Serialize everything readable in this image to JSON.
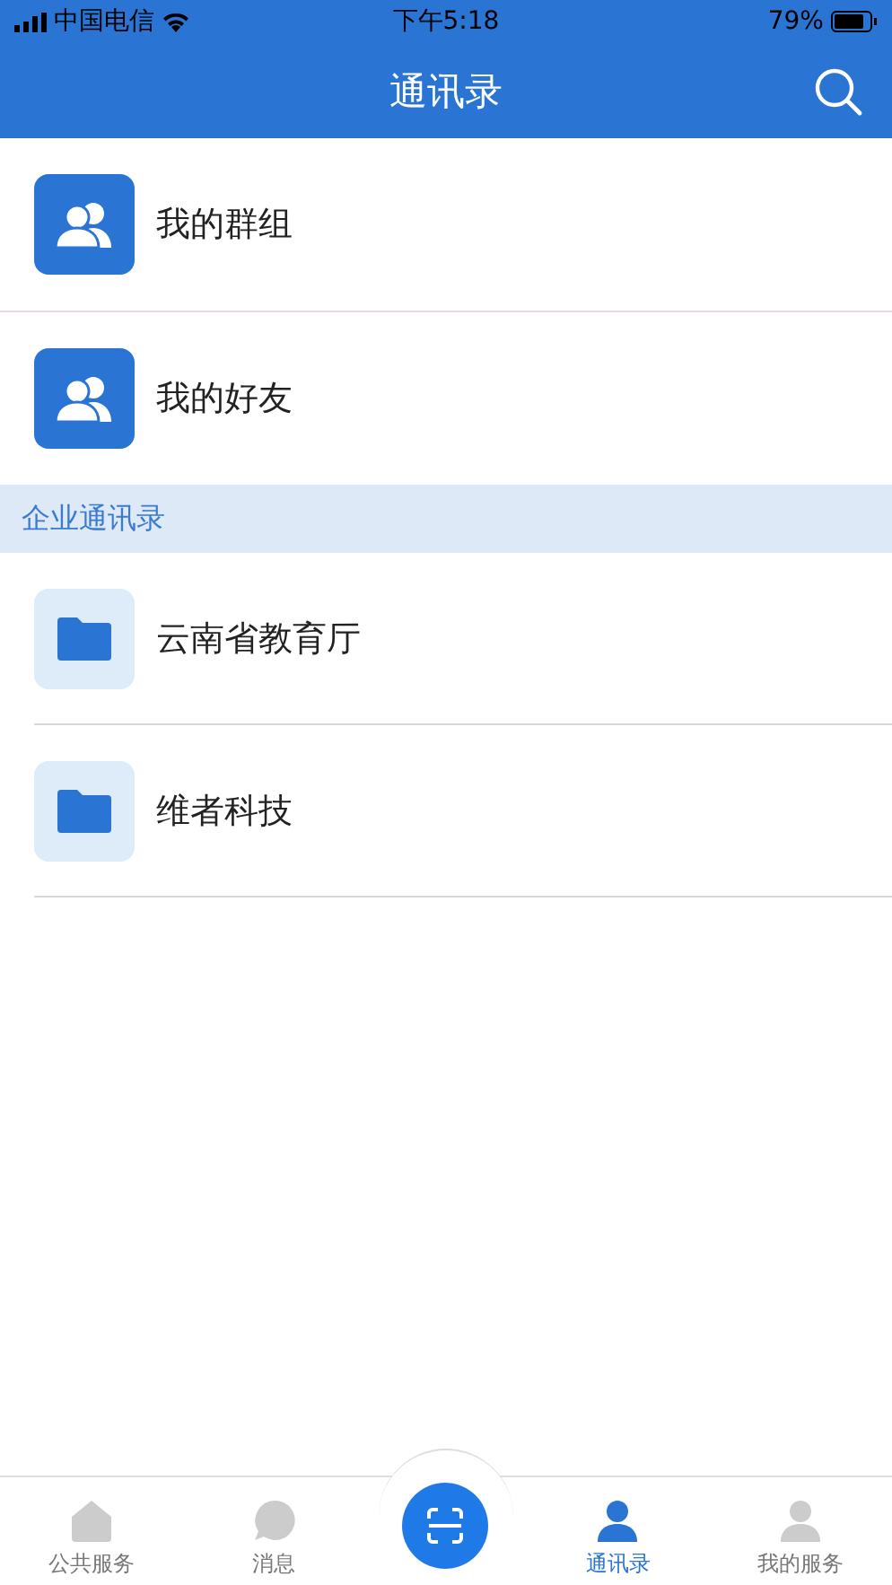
{
  "status_bar": {
    "carrier": "中国电信",
    "time": "下午5:18",
    "battery": "79%"
  },
  "header": {
    "title": "通讯录"
  },
  "contacts": [
    {
      "label": "我的群组"
    },
    {
      "label": "我的好友"
    }
  ],
  "section": {
    "title": "企业通讯录"
  },
  "orgs": [
    {
      "label": "云南省教育厅"
    },
    {
      "label": "维者科技"
    }
  ],
  "tabs": [
    {
      "kind": "home",
      "label": "公共服务",
      "selected": false
    },
    {
      "kind": "chat",
      "label": "消息",
      "selected": false
    },
    {
      "kind": "scan"
    },
    {
      "kind": "contacts",
      "label": "通讯录",
      "selected": true
    },
    {
      "kind": "user",
      "label": "我的服务",
      "selected": false
    }
  ]
}
